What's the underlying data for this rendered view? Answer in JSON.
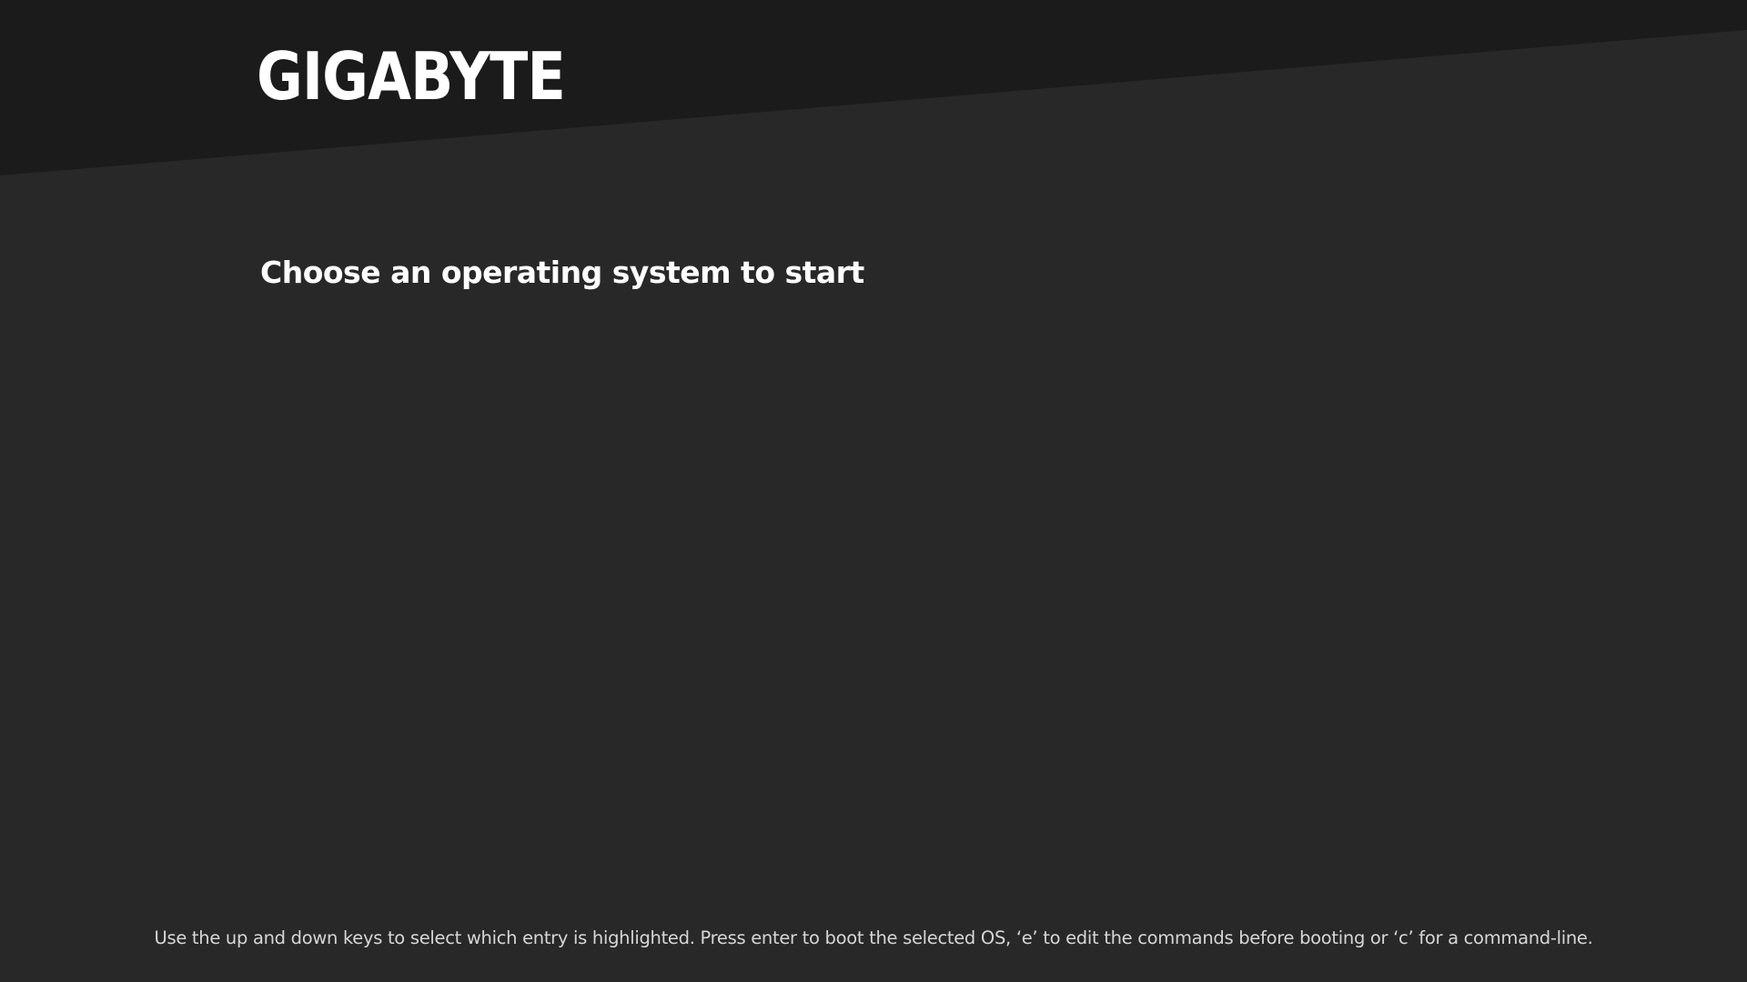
{
  "screen": {
    "background_color": "#282828",
    "header_band_color": "#1b1b1b"
  },
  "branding": {
    "logo_text": "GIGABYTE",
    "logo_color": "#ffffff"
  },
  "menu": {
    "title": "Choose an operating system to start",
    "entries": []
  },
  "footer": {
    "help_text": "Use the up and down keys to select which entry is highlighted. Press enter to boot the selected OS, ‘e’ to edit the commands before booting or ‘c’ for a command-line."
  }
}
